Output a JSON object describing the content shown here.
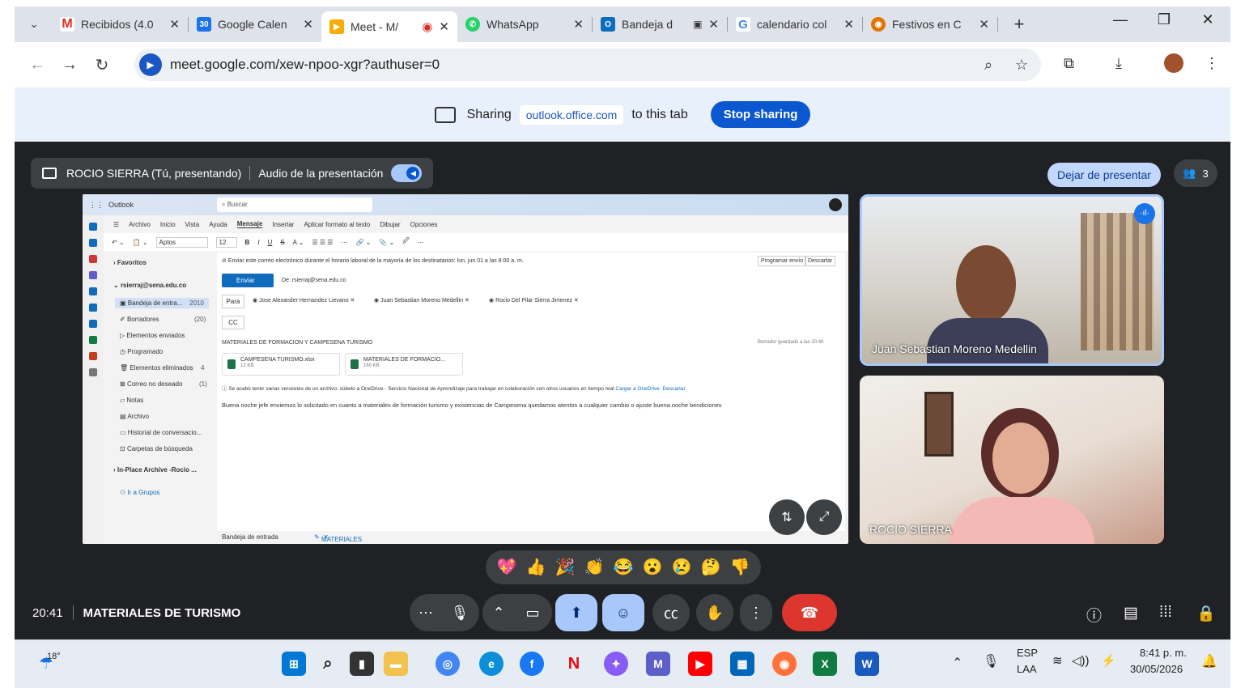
{
  "browser": {
    "tabs": [
      {
        "label": "Recibidos (4.0",
        "icon": "gmail-icon",
        "color": "#d93025",
        "glyph": "M"
      },
      {
        "label": "Google Calen",
        "icon": "calendar-icon",
        "color": "#1a73e8",
        "glyph": "30"
      },
      {
        "label": "Meet - M/",
        "icon": "meet-icon",
        "color": "#f9ab00",
        "glyph": "▶"
      },
      {
        "label": "WhatsApp",
        "icon": "whatsapp-icon",
        "color": "#25d366",
        "glyph": "✆"
      },
      {
        "label": "Bandeja d",
        "icon": "outlook-icon",
        "color": "#0f6cbd",
        "glyph": "O"
      },
      {
        "label": "calendario col",
        "icon": "google-icon",
        "color": "#4285f4",
        "glyph": "G"
      },
      {
        "label": "Festivos en C",
        "icon": "globe-icon",
        "color": "#e37400",
        "glyph": "◉"
      }
    ],
    "new_tab": "+",
    "url": "meet.google.com/xew-npoo-xgr?authuser=0"
  },
  "sharebar": {
    "sharing": "Sharing",
    "site": "outlook.office.com",
    "to_tab": "to this tab",
    "stop": "Stop sharing"
  },
  "meet": {
    "presenter": "ROCIO SIERRA (Tú, presentando)",
    "audio": "Audio de la presentación",
    "stop_presenting": "Dejar de presentar",
    "people_count": "3",
    "participants": [
      "Juan Sebastian Moreno Medellin",
      "ROCIO SIERRA"
    ],
    "time": "20:41",
    "meeting_title": "MATERIALES DE TURISMO",
    "reactions": [
      "💖",
      "👍",
      "🎉",
      "👏",
      "😂",
      "😮",
      "😢",
      "🤔",
      "👎"
    ]
  },
  "outlook": {
    "app": "Outlook",
    "search": "Buscar",
    "menu": [
      "Archivo",
      "Inicio",
      "Vista",
      "Ayuda",
      "Mensaje",
      "Insertar",
      "Aplicar formato al texto",
      "Dibujar",
      "Opciones"
    ],
    "font": "Aptos",
    "font_size": "12",
    "favorites": "Favoritos",
    "account": "rsierraj@sena.edu.co",
    "folders": [
      {
        "name": "Bandeja de entra...",
        "count": "2010"
      },
      {
        "name": "Borradores",
        "count": "(20)"
      },
      {
        "name": "Elementos enviados",
        "count": ""
      },
      {
        "name": "Programado",
        "count": ""
      },
      {
        "name": "Elementos eliminados",
        "count": "4"
      },
      {
        "name": "Correo no deseado",
        "count": "(1)"
      },
      {
        "name": "Notas",
        "count": ""
      },
      {
        "name": "Archivo",
        "count": ""
      },
      {
        "name": "Historial de conversacio...",
        "count": ""
      },
      {
        "name": "Carpetas de búsqueda",
        "count": ""
      }
    ],
    "archive": "In-Place Archive -Rocio ...",
    "groups": "Ir a Grupos",
    "schedule_notice": "Enviar este correo electrónico durante el horario laboral de la mayoría de los destinatarios: lun, jun 01 a las 8:00 a. m.",
    "schedule_btn": "Programar envío",
    "discard_btn": "Descartar",
    "send": "Enviar",
    "from": "De: rsierraj@sena.edu.co",
    "to_label": "Para",
    "cc_label": "CC",
    "recipients": [
      "Jose Alexander Hernandez Lievano",
      "Juan Sebastian Moreno Medellin",
      "Rocio Del Pilar Sierra Jimenez"
    ],
    "subject": "MATERIALES DE FORMACION Y CAMPESENA TURISMO",
    "draft_saved": "Borrador guardado a las 20:40",
    "attachments": [
      {
        "name": "CAMPESENA TURISMO.xlsx",
        "size": "12 KB"
      },
      {
        "name": "MATERIALES DE FORMACIO...",
        "size": "160 KB"
      }
    ],
    "version_notice": "Se acabó tener varias versiones de un archivo: súbelo a OneDrive - Servicio Nacional de Aprendizaje para trabajar en colaboración con otros usuarios en tiempo real",
    "upload_link": "Cargar a OneDrive",
    "discard_link": "Descartar",
    "body": "Buena noche jefe enviemos lo solicitado en cuanto a materiales de formación turismo y existencias de Campesena  quedamos atentos a cualquier cambio o ajuste  buena noche bendiciones",
    "bottom_tab1": "Bandeja de entrada",
    "bottom_tab2": "MATERIALES DE F..."
  },
  "taskbar": {
    "weather": "18°",
    "lang1": "ESP",
    "lang2": "LAA",
    "time": "8:41 p. m.",
    "date": "30/05/2026"
  }
}
